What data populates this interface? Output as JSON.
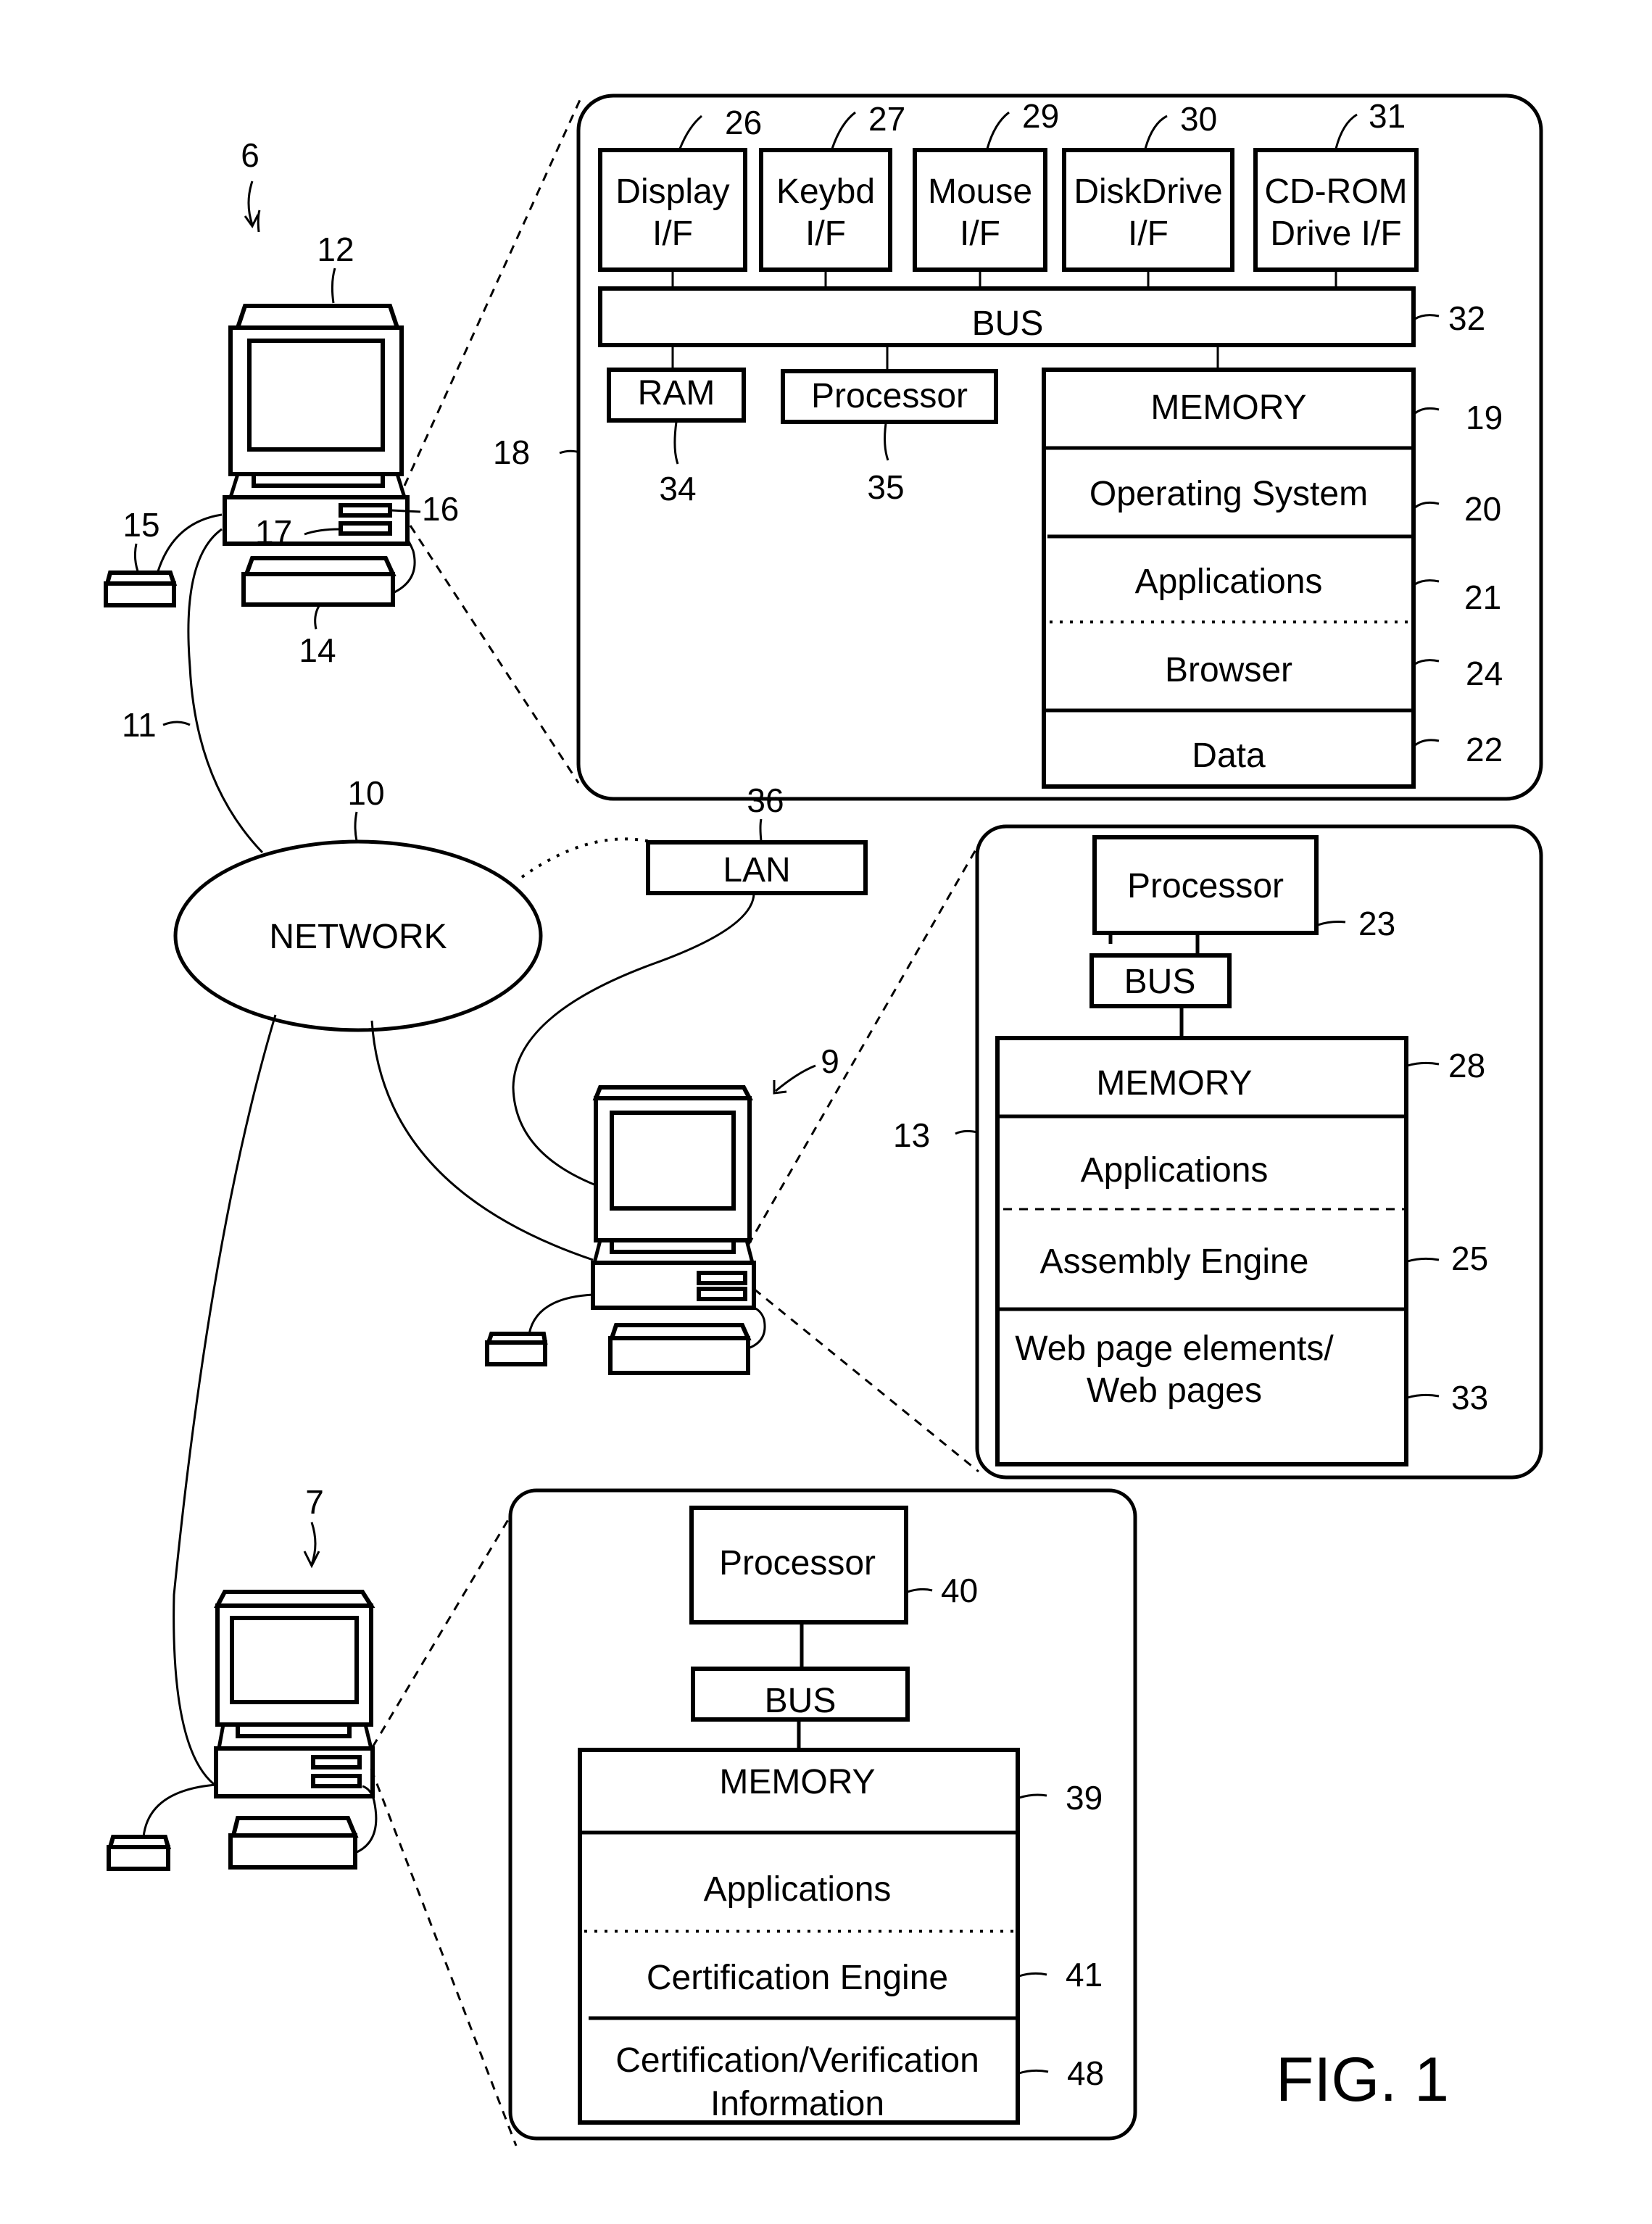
{
  "figure_label": "FIG. 1",
  "network": {
    "label": "NETWORK",
    "ref": "10"
  },
  "lan": {
    "label": "LAN",
    "ref": "36"
  },
  "link_ref": "11",
  "client_computer": {
    "ref": "6",
    "monitor_ref": "12",
    "keyboard_ref": "14",
    "mouse_ref": "15",
    "drive1_ref": "16",
    "drive2_ref": "17"
  },
  "server_computer": {
    "ref": "9"
  },
  "certifier_computer": {
    "ref": "7"
  },
  "client_detail": {
    "ref": "18",
    "interfaces": [
      {
        "line1": "Display",
        "line2": "I/F",
        "ref": "26"
      },
      {
        "line1": "Keybd",
        "line2": "I/F",
        "ref": "27"
      },
      {
        "line1": "Mouse",
        "line2": "I/F",
        "ref": "29"
      },
      {
        "line1": "DiskDrive",
        "line2": "I/F",
        "ref": "30"
      },
      {
        "line1": "CD-ROM",
        "line2": "Drive I/F",
        "ref": "31"
      }
    ],
    "bus": {
      "label": "BUS",
      "ref": "32"
    },
    "ram": {
      "label": "RAM",
      "ref": "34"
    },
    "processor": {
      "label": "Processor",
      "ref": "35"
    },
    "memory": [
      {
        "label": "MEMORY",
        "ref": "19"
      },
      {
        "label": "Operating System",
        "ref": "20"
      },
      {
        "label": "Applications",
        "ref": "21"
      },
      {
        "label": "Browser",
        "ref": "24"
      },
      {
        "label": "Data",
        "ref": "22"
      }
    ]
  },
  "server_detail": {
    "ref": "13",
    "processor": {
      "label": "Processor",
      "ref": "23"
    },
    "bus": {
      "label": "BUS"
    },
    "memory": [
      {
        "label": "MEMORY",
        "ref": "28"
      },
      {
        "label": "Applications",
        "ref": ""
      },
      {
        "label": "Assembly Engine",
        "ref": "25"
      },
      {
        "line1": "Web page elements/",
        "line2": "Web pages",
        "ref": "33"
      }
    ]
  },
  "certifier_detail": {
    "processor": {
      "label": "Processor",
      "ref": "40"
    },
    "bus": {
      "label": "BUS"
    },
    "memory": [
      {
        "label": "MEMORY",
        "ref": "39"
      },
      {
        "label": "Applications",
        "ref": ""
      },
      {
        "label": "Certification Engine",
        "ref": "41"
      },
      {
        "line1": "Certification/Verification",
        "line2": "Information",
        "ref": "48"
      }
    ]
  }
}
